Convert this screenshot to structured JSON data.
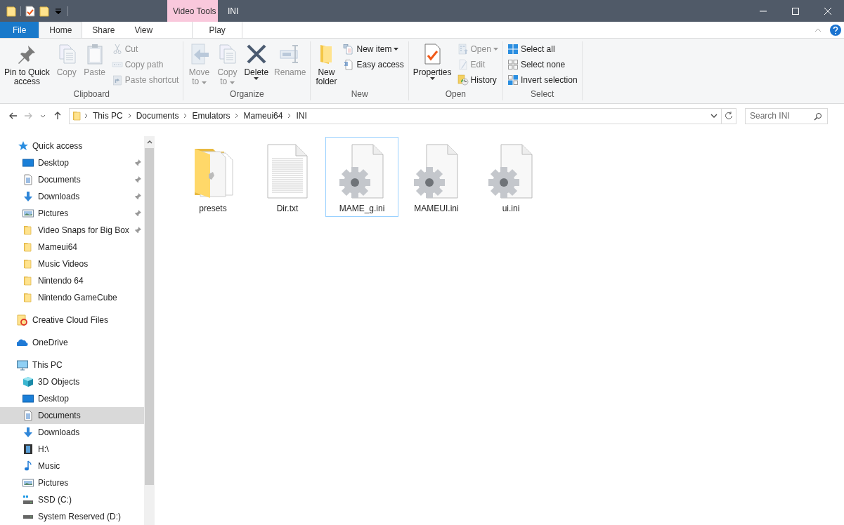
{
  "window": {
    "title": "INI"
  },
  "contextual_group": {
    "label": "Video Tools"
  },
  "tabs": [
    {
      "label": "File",
      "kind": "file",
      "selected": false
    },
    {
      "label": "Home",
      "kind": "normal",
      "selected": true
    },
    {
      "label": "Share",
      "kind": "normal",
      "selected": false
    },
    {
      "label": "View",
      "kind": "normal",
      "selected": false
    },
    {
      "label": "Play",
      "kind": "contextual",
      "selected": false
    }
  ],
  "ribbon": {
    "groups": [
      {
        "label": "Clipboard",
        "items": [
          {
            "kind": "pin",
            "large": true,
            "lines": [
              "Pin to Quick",
              "access"
            ],
            "disabled": false,
            "menu": false
          },
          {
            "kind": "copy",
            "large": true,
            "lines": [
              "Copy"
            ],
            "disabled": true,
            "menu": false
          },
          {
            "kind": "paste",
            "large": true,
            "lines": [
              "Paste"
            ],
            "disabled": true,
            "menu": false
          },
          {
            "kind": "cut",
            "large": false,
            "lines": [
              "Cut"
            ],
            "disabled": true,
            "menu": false
          },
          {
            "kind": "copypath",
            "large": false,
            "lines": [
              "Copy path"
            ],
            "disabled": true,
            "menu": false
          },
          {
            "kind": "shortcut",
            "large": false,
            "lines": [
              "Paste shortcut"
            ],
            "disabled": true,
            "menu": false
          }
        ]
      },
      {
        "label": "Organize",
        "items": [
          {
            "kind": "move",
            "large": true,
            "lines": [
              "Move",
              "to"
            ],
            "disabled": true,
            "menu": true
          },
          {
            "kind": "copyto",
            "large": true,
            "lines": [
              "Copy",
              "to"
            ],
            "disabled": true,
            "menu": true
          },
          {
            "kind": "delete",
            "large": true,
            "lines": [
              "Delete"
            ],
            "disabled": false,
            "menu": true
          },
          {
            "kind": "rename",
            "large": true,
            "lines": [
              "Rename"
            ],
            "disabled": true,
            "menu": false
          }
        ]
      },
      {
        "label": "New",
        "items": [
          {
            "kind": "newfolder",
            "large": true,
            "lines": [
              "New",
              "folder"
            ],
            "disabled": false,
            "menu": false
          },
          {
            "kind": "newitem",
            "large": false,
            "lines": [
              "New item"
            ],
            "disabled": false,
            "menu": true
          },
          {
            "kind": "easy",
            "large": false,
            "lines": [
              "Easy access"
            ],
            "disabled": false,
            "menu": false
          }
        ]
      },
      {
        "label": "Open",
        "items": [
          {
            "kind": "properties",
            "large": true,
            "lines": [
              "Properties"
            ],
            "disabled": false,
            "menu": true
          },
          {
            "kind": "open",
            "large": false,
            "lines": [
              "Open"
            ],
            "disabled": true,
            "menu": true
          },
          {
            "kind": "edit",
            "large": false,
            "lines": [
              "Edit"
            ],
            "disabled": true,
            "menu": false
          },
          {
            "kind": "history",
            "large": false,
            "lines": [
              "History"
            ],
            "disabled": false,
            "menu": false
          }
        ]
      },
      {
        "label": "Select",
        "items": [
          {
            "kind": "selectall",
            "large": false,
            "lines": [
              "Select all"
            ],
            "disabled": false,
            "menu": false
          },
          {
            "kind": "selectnone",
            "large": false,
            "lines": [
              "Select none"
            ],
            "disabled": false,
            "menu": false
          },
          {
            "kind": "invert",
            "large": false,
            "lines": [
              "Invert selection"
            ],
            "disabled": false,
            "menu": false
          }
        ]
      }
    ]
  },
  "address": {
    "crumbs": [
      "This PC",
      "Documents",
      "Emulators",
      "Mameui64",
      "INI"
    ]
  },
  "search": {
    "placeholder": "Search INI"
  },
  "sidebar": {
    "sections": [
      {
        "label": "Quick access",
        "kind": "star",
        "selected": false,
        "children": [
          {
            "label": "Desktop",
            "kind": "desktop",
            "pinned": true,
            "selected": false
          },
          {
            "label": "Documents",
            "kind": "documents",
            "pinned": true,
            "selected": false
          },
          {
            "label": "Downloads",
            "kind": "downloads",
            "pinned": true,
            "selected": false
          },
          {
            "label": "Pictures",
            "kind": "pictures",
            "pinned": true,
            "selected": false
          },
          {
            "label": "Video Snaps for Big Box",
            "kind": "folder",
            "pinned": true,
            "selected": false
          },
          {
            "label": "Mameui64",
            "kind": "folder",
            "pinned": false,
            "selected": false
          },
          {
            "label": "Music Videos",
            "kind": "folder",
            "pinned": false,
            "selected": false
          },
          {
            "label": "Nintendo 64",
            "kind": "folder",
            "pinned": false,
            "selected": false
          },
          {
            "label": "Nintendo GameCube",
            "kind": "folder",
            "pinned": false,
            "selected": false
          }
        ]
      },
      {
        "label": "Creative Cloud Files",
        "kind": "ccfolder",
        "selected": false
      },
      {
        "label": "OneDrive",
        "kind": "cloud",
        "selected": false
      },
      {
        "label": "This PC",
        "kind": "pc",
        "selected": false,
        "children": [
          {
            "label": "3D Objects",
            "kind": "cube",
            "pinned": false,
            "selected": false
          },
          {
            "label": "Desktop",
            "kind": "desktop",
            "pinned": false,
            "selected": false
          },
          {
            "label": "Documents",
            "kind": "documents",
            "pinned": false,
            "selected": true
          },
          {
            "label": "Downloads",
            "kind": "downloads",
            "pinned": false,
            "selected": false
          },
          {
            "label": "H:\\",
            "kind": "film",
            "pinned": false,
            "selected": false
          },
          {
            "label": "Music",
            "kind": "music",
            "pinned": false,
            "selected": false
          },
          {
            "label": "Pictures",
            "kind": "pictures",
            "pinned": false,
            "selected": false
          },
          {
            "label": "SSD (C:)",
            "kind": "windrive",
            "pinned": false,
            "selected": false
          },
          {
            "label": "System Reserved (D:)",
            "kind": "drive",
            "pinned": false,
            "selected": false
          }
        ]
      }
    ]
  },
  "files": [
    {
      "name": "presets",
      "kind": "folder",
      "selected": false
    },
    {
      "name": "Dir.txt",
      "kind": "text",
      "selected": false
    },
    {
      "name": "MAME_g.ini",
      "kind": "settings",
      "selected": true
    },
    {
      "name": "MAMEUI.ini",
      "kind": "settings",
      "selected": false
    },
    {
      "name": "ui.ini",
      "kind": "settings",
      "selected": false
    }
  ]
}
